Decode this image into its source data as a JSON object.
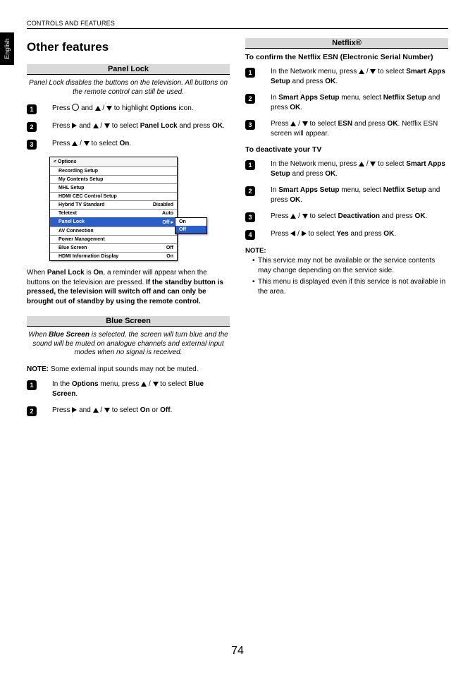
{
  "header": "CONTROLS AND FEATURES",
  "language_tab": "English",
  "page_title": "Other features",
  "page_number": "74",
  "left": {
    "panel_lock": {
      "heading": "Panel Lock",
      "intro": "Panel Lock disables the buttons on the television. All buttons on the remote control can still be used.",
      "steps": {
        "s1a": "Press ",
        "s1b": " and ",
        "s1c": " to highlight ",
        "s1d": "Options",
        "s1e": " icon.",
        "s2a": "Press ",
        "s2b": " and ",
        "s2c": " to select ",
        "s2d": "Panel Lock",
        "s2e": " and press ",
        "s2f": "OK",
        "s2g": ".",
        "s3a": "Press ",
        "s3b": " to select ",
        "s3c": "On",
        "s3d": "."
      },
      "menu": {
        "title": "< Options",
        "rows": [
          {
            "label": "Recording Setup",
            "value": ""
          },
          {
            "label": "My Contents Setup",
            "value": ""
          },
          {
            "label": "MHL Setup",
            "value": ""
          },
          {
            "label": "HDMI CEC Control Setup",
            "value": ""
          },
          {
            "label": "Hybrid TV Standard",
            "value": "Disabled"
          },
          {
            "label": "Teletext",
            "value": "Auto"
          },
          {
            "label": "Panel Lock",
            "value": "Off ▸",
            "hl": true
          },
          {
            "label": "AV Connection",
            "value": ""
          },
          {
            "label": "Power Management",
            "value": ""
          },
          {
            "label": "Blue Screen",
            "value": "Off"
          },
          {
            "label": "HDMI Information Display",
            "value": "On"
          }
        ],
        "submenu": {
          "on": "On",
          "off": "Off"
        }
      },
      "after_a": "When ",
      "after_b": "Panel Lock",
      "after_c": " is ",
      "after_d": "On",
      "after_e": ", a reminder will appear when the buttons on the television are pressed. ",
      "after_f": "If the standby button is pressed, the television will switch off and can only be brought out of standby by using the remote control."
    },
    "blue_screen": {
      "heading": "Blue Screen",
      "intro_a": "When ",
      "intro_b": "Blue Screen",
      "intro_c": " is selected, the screen will turn blue and the sound will be muted on analogue channels and external input modes when no signal is received.",
      "note_a": "NOTE:",
      "note_b": " Some external input sounds may not be muted.",
      "steps": {
        "s1a": "In the ",
        "s1b": "Options",
        "s1c": " menu, press ",
        "s1d": " to select ",
        "s1e": "Blue Screen",
        "s1f": ".",
        "s2a": "Press ",
        "s2b": " and ",
        "s2c": " to select ",
        "s2d": "On",
        "s2e": " or ",
        "s2f": "Off",
        "s2g": "."
      }
    }
  },
  "right": {
    "netflix": {
      "heading": "Netflix®",
      "sub1": "To confirm the Netflix ESN (Electronic Serial Number)",
      "esn_steps": {
        "s1a": "In the Network menu, press ",
        "s1b": " to select ",
        "s1c": "Smart Apps Setup",
        "s1d": " and press ",
        "s1e": "OK",
        "s1f": ".",
        "s2a": "In ",
        "s2b": "Smart Apps Setup",
        "s2c": " menu, select ",
        "s2d": "Netflix Setup",
        "s2e": " and press ",
        "s2f": "OK",
        "s2g": ".",
        "s3a": "Press ",
        "s3b": " to select ",
        "s3c": "ESN",
        "s3d": " and press ",
        "s3e": "OK",
        "s3f": ". Netflix ESN screen will appear."
      },
      "sub2": "To deactivate your TV",
      "deact_steps": {
        "s1a": "In the Network menu, press ",
        "s1b": " to select ",
        "s1c": "Smart Apps Setup",
        "s1d": " and press ",
        "s1e": "OK",
        "s1f": ".",
        "s2a": "In ",
        "s2b": "Smart Apps Setup",
        "s2c": " menu, select ",
        "s2d": "Netflix Setup",
        "s2e": " and press ",
        "s2f": "OK",
        "s2g": ".",
        "s3a": "Press ",
        "s3b": " to select ",
        "s3c": "Deactivation",
        "s3d": " and press ",
        "s3e": "OK",
        "s3f": ".",
        "s4a": "Press ",
        "s4b": " to select ",
        "s4c": "Yes",
        "s4d": " and press ",
        "s4e": "OK",
        "s4f": "."
      },
      "note_label": "NOTE:",
      "notes": [
        "This service may not be available or the service contents may change depending on the service side.",
        "This menu is displayed even if this service is not available in the area."
      ]
    }
  }
}
